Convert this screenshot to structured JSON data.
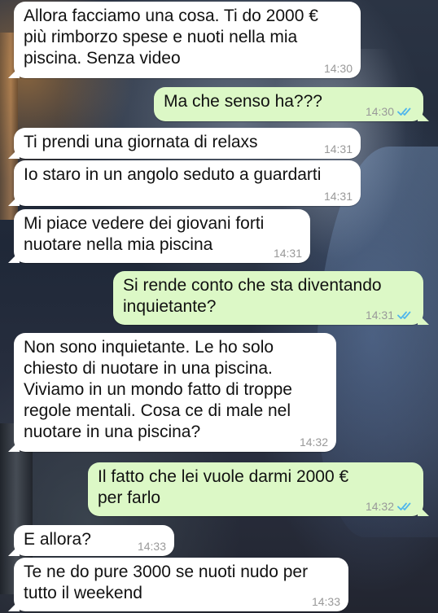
{
  "messages": [
    {
      "dir": "in",
      "lines": [
        "Allora facciamo una cosa. Ti do 2000 €",
        "più rimborzo spese e nuoti nella mia",
        "piscina. Senza video"
      ],
      "time": "14:30"
    },
    {
      "dir": "out",
      "lines": [
        "Ma che senso ha???"
      ],
      "time": "14:30",
      "status": "read"
    },
    {
      "dir": "in",
      "lines": [
        "Ti prendi una giornata di relaxs"
      ],
      "time": "14:31"
    },
    {
      "dir": "in",
      "lines": [
        "Io staro in un angolo seduto a guardarti"
      ],
      "time": "14:31"
    },
    {
      "dir": "in",
      "lines": [
        "Mi piace vedere dei giovani forti",
        "nuotare nella mia piscina"
      ],
      "time": "14:31"
    },
    {
      "dir": "out",
      "lines": [
        "Si rende conto che sta diventando",
        "inquietante?"
      ],
      "time": "14:31",
      "status": "read"
    },
    {
      "dir": "in",
      "lines": [
        "Non sono inquietante. Le ho solo",
        "chiesto di nuotare in una piscina.",
        "Viviamo in un mondo fatto di troppe",
        "regole mentali. Cosa ce di male nel",
        "nuotare in una piscina?"
      ],
      "time": "14:32"
    },
    {
      "dir": "out",
      "lines": [
        "Il fatto che lei vuole darmi 2000 €",
        "per farlo"
      ],
      "time": "14:32",
      "status": "read"
    },
    {
      "dir": "in",
      "lines": [
        "E allora?"
      ],
      "time": "14:33"
    },
    {
      "dir": "in",
      "lines": [
        "Te ne do pure 3000 se nuoti nudo per",
        "tutto il weekend"
      ],
      "time": "14:33"
    }
  ],
  "colors": {
    "incoming": "#ffffff",
    "outgoing": "#dcf8c6",
    "read_ticks": "#4fb6ec",
    "time_text": "#999999"
  },
  "icons": {
    "read_receipt": "double-check-icon"
  }
}
